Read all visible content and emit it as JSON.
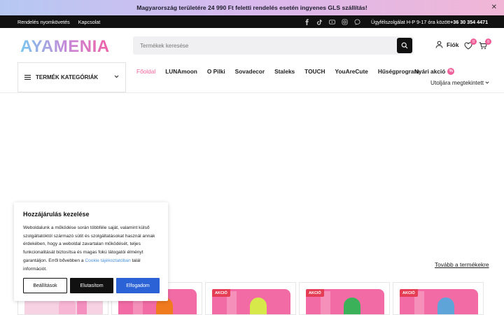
{
  "announcement": {
    "text": "Magyarország területére 24 990 Ft feletti rendelés esetén ingyenes GLS szállítás!"
  },
  "topbar": {
    "links": [
      "Rendelés nyomkövetés",
      "Kapcsolat"
    ],
    "socials": [
      "facebook-icon",
      "tiktok-icon",
      "youtube-icon",
      "instagram-icon",
      "messenger-icon"
    ],
    "service_text": "Ügyfélszolgálat H-P 9-17 óra között",
    "phone": "+36 30 354 4471"
  },
  "header": {
    "logo_text": "AYAMENIA",
    "search_placeholder": "Termékek keresése",
    "account_label": "Fiók",
    "wishlist_count": "0",
    "cart_count": "0"
  },
  "categories": {
    "label": "TERMÉK KATEGÓRIÁK"
  },
  "nav": {
    "items": [
      "Főoldal",
      "LUNAmoon",
      "O Pilki",
      "Sovadecor",
      "Staleks",
      "TOUCH",
      "YouAreCute",
      "Hűségprogram"
    ],
    "sale_label": "Nyári akció",
    "sale_badge": "%",
    "recent_label": "Utoljára megtekintett"
  },
  "cookie": {
    "title": "Hozzájárulás kezelése",
    "body": "Weboldalunk a működése során többféle saját, valamint külső szolgáltatóktól származó sütit és szolgáltatásokat használ annak érdekében, hogy a weboldal zavartalan működését, teljes funkcionalitását biztosítsa és magas fokú látogatói élményt garantáljon. Erről bővebben a",
    "link": "Cookie tájékoztatóban",
    "body_end": " talál információt.",
    "settings_label": "Beállítások",
    "decline_label": "Elutasítom",
    "accept_label": "Elfogadom"
  },
  "products": {
    "more_label": "Tovább a termékekre",
    "sale_tag": "AKCIÓ",
    "cards": [
      {
        "tag": "",
        "bottle_color": "#f8b6d5"
      },
      {
        "tag": "",
        "bottle_color": "#f07a1e"
      },
      {
        "tag": "AKCIÓ",
        "bottle_color": "#d6e84a"
      },
      {
        "tag": "AKCIÓ",
        "bottle_color": "#3bb25a"
      },
      {
        "tag": "AKCIÓ",
        "bottle_color": "#5fa4d8"
      }
    ]
  },
  "colors": {
    "accent": "#f05f9a",
    "accept_button": "#2b63d6",
    "sale_tag": "#e43d54"
  }
}
